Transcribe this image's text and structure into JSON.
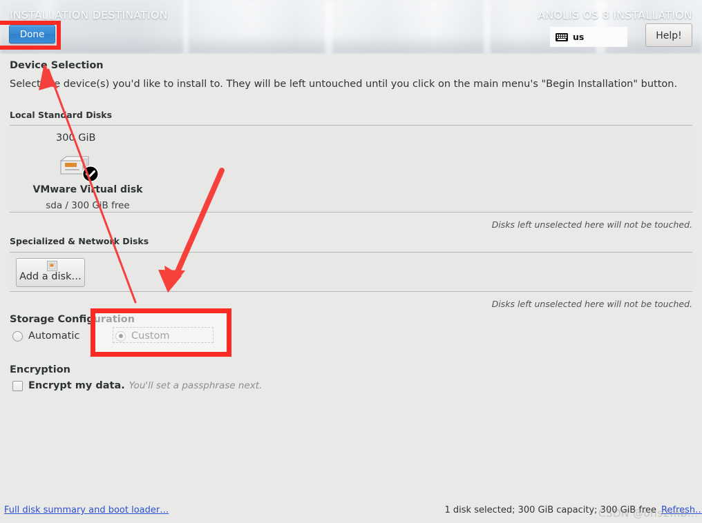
{
  "header": {
    "title_left": "INSTALLATION DESTINATION",
    "title_right": "ANOLIS OS 8 INSTALLATION",
    "done_label": "Done",
    "keyboard_layout": "us",
    "keyboard_icon": "keyboard-icon",
    "help_label": "Help!"
  },
  "device_selection": {
    "heading": "Device Selection",
    "description": "Select the device(s) you'd like to install to.  They will be left untouched until you click on the main menu's \"Begin Installation\" button.",
    "local_disks_label": "Local Standard Disks",
    "local_note": "Disks left unselected here will not be touched.",
    "disks": [
      {
        "capacity": "300 GiB",
        "name": "VMware Virtual disk",
        "sub": "sda  /  300 GiB free",
        "icon": "hard-disk-icon",
        "selected_badge": "checkmark-badge-icon",
        "selected": true
      }
    ],
    "specialized_label": "Specialized & Network Disks",
    "add_disk_label": "Add a disk…",
    "add_disk_icon": "add-disk-icon",
    "specialized_note": "Disks left unselected here will not be touched."
  },
  "storage_configuration": {
    "heading": "Storage Configuration",
    "options": [
      {
        "label": "Automatic",
        "selected": false
      },
      {
        "label": "Custom",
        "selected": true
      }
    ]
  },
  "encryption": {
    "heading": "Encryption",
    "checkbox_label": "Encrypt my data.",
    "hint": "You'll set a passphrase next.",
    "checked": false
  },
  "footer": {
    "summary_link": "Full disk summary and boot loader…",
    "status": "1 disk selected; 300 GiB capacity; 300 GiB free",
    "refresh_link": "Refresh…"
  },
  "watermark": {
    "text": "CSDN @ons2mb..."
  },
  "annotations": {
    "highlight_color": "#fa2a25",
    "boxes": [
      {
        "name": "done-button-highlight"
      },
      {
        "name": "custom-option-highlight"
      }
    ],
    "arrows": [
      {
        "name": "arrow-to-device-selection"
      },
      {
        "name": "arrow-to-specialized-disks"
      }
    ]
  }
}
